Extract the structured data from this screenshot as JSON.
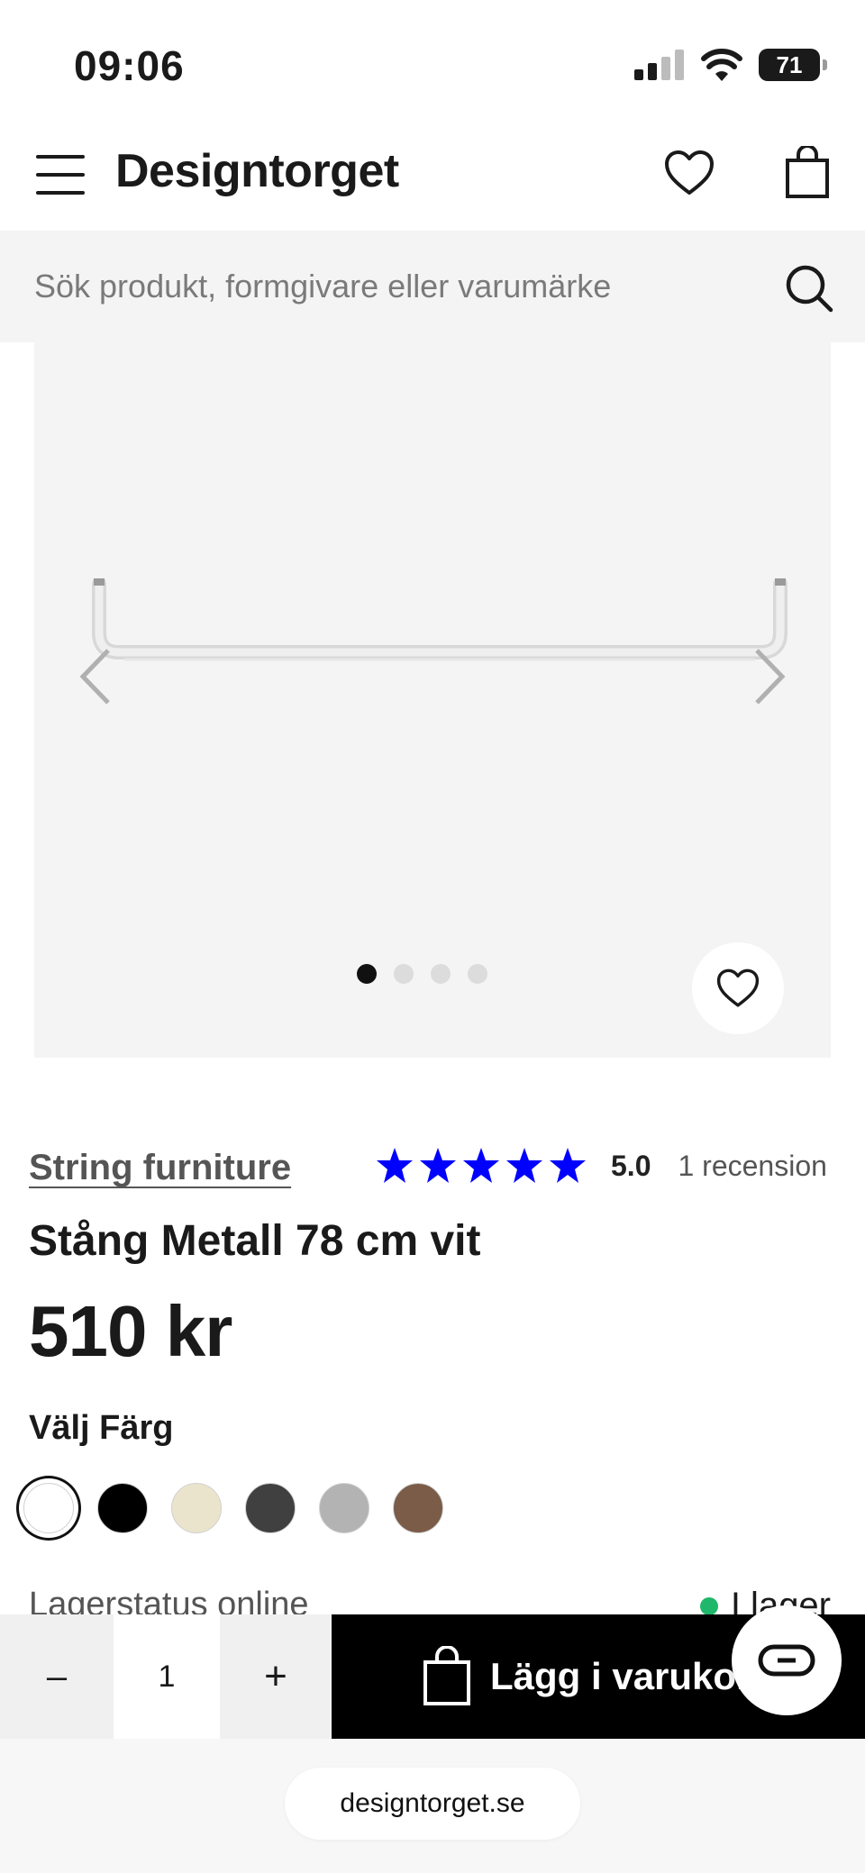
{
  "status_bar": {
    "time": "09:06",
    "battery": "71"
  },
  "header": {
    "brand": "Designtorget"
  },
  "search": {
    "placeholder": "Sök produkt, formgivare eller varumärke"
  },
  "gallery": {
    "slide_count": 4,
    "active_slide": 1
  },
  "product": {
    "brand": "String furniture",
    "rating": "5.0",
    "rating_stars": 5,
    "review_count": "1 recension",
    "title": "Stång Metall 78 cm vit",
    "price": "510 kr"
  },
  "colors": {
    "heading": "Välj Färg",
    "options": [
      {
        "name": "white",
        "hex": "#ffffff",
        "selected": true
      },
      {
        "name": "black",
        "hex": "#000000",
        "selected": false
      },
      {
        "name": "beige",
        "hex": "#ebe4cc",
        "selected": false
      },
      {
        "name": "dark-grey",
        "hex": "#404040",
        "selected": false
      },
      {
        "name": "grey",
        "hex": "#b3b3b3",
        "selected": false
      },
      {
        "name": "brown",
        "hex": "#7a5c48",
        "selected": false
      }
    ]
  },
  "stock": {
    "label": "Lagerstatus online",
    "status": "I lager",
    "status_color": "#1fb86a"
  },
  "cart": {
    "minus": "–",
    "quantity": "1",
    "plus": "+",
    "add_label": "Lägg i varukorg"
  },
  "browser": {
    "url": "designtorget.se"
  },
  "accent": {
    "star_color": "#0000ff"
  }
}
